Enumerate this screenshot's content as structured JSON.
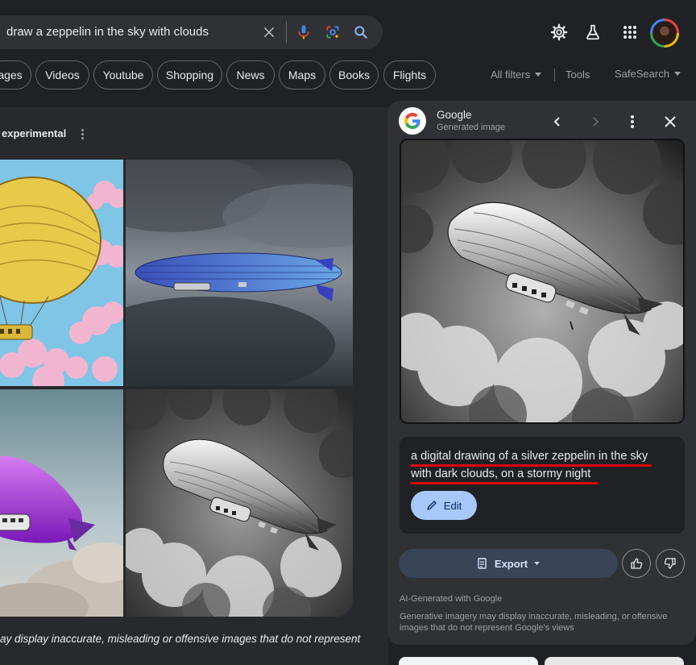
{
  "search": {
    "query": "draw a zeppelin in the sky with clouds"
  },
  "tabs": [
    "ages",
    "Videos",
    "Youtube",
    "Shopping",
    "News",
    "Maps",
    "Books",
    "Flights"
  ],
  "filters": {
    "all_filters": "All filters",
    "tools": "Tools",
    "safesearch": "SafeSearch"
  },
  "left": {
    "section_title": "experimental",
    "disclaimer": "ay display inaccurate, misleading or offensive images that do not represent"
  },
  "side_panel": {
    "title": "Google",
    "subtitle": "Generated image",
    "prompt_line1": "a digital drawing of a silver zeppelin in the sky",
    "prompt_line2": "with dark clouds, on a stormy night",
    "edit_label": "Edit",
    "export_label": "Export",
    "ai_label": "AI-Generated with Google",
    "ai_note": "Generative imagery may display inaccurate, misleading, or offensive images that do not represent Google's views"
  },
  "colors": {
    "background": "#202124",
    "panel": "#303134",
    "accent": "#a8c7fa",
    "underline": "#e00000"
  }
}
